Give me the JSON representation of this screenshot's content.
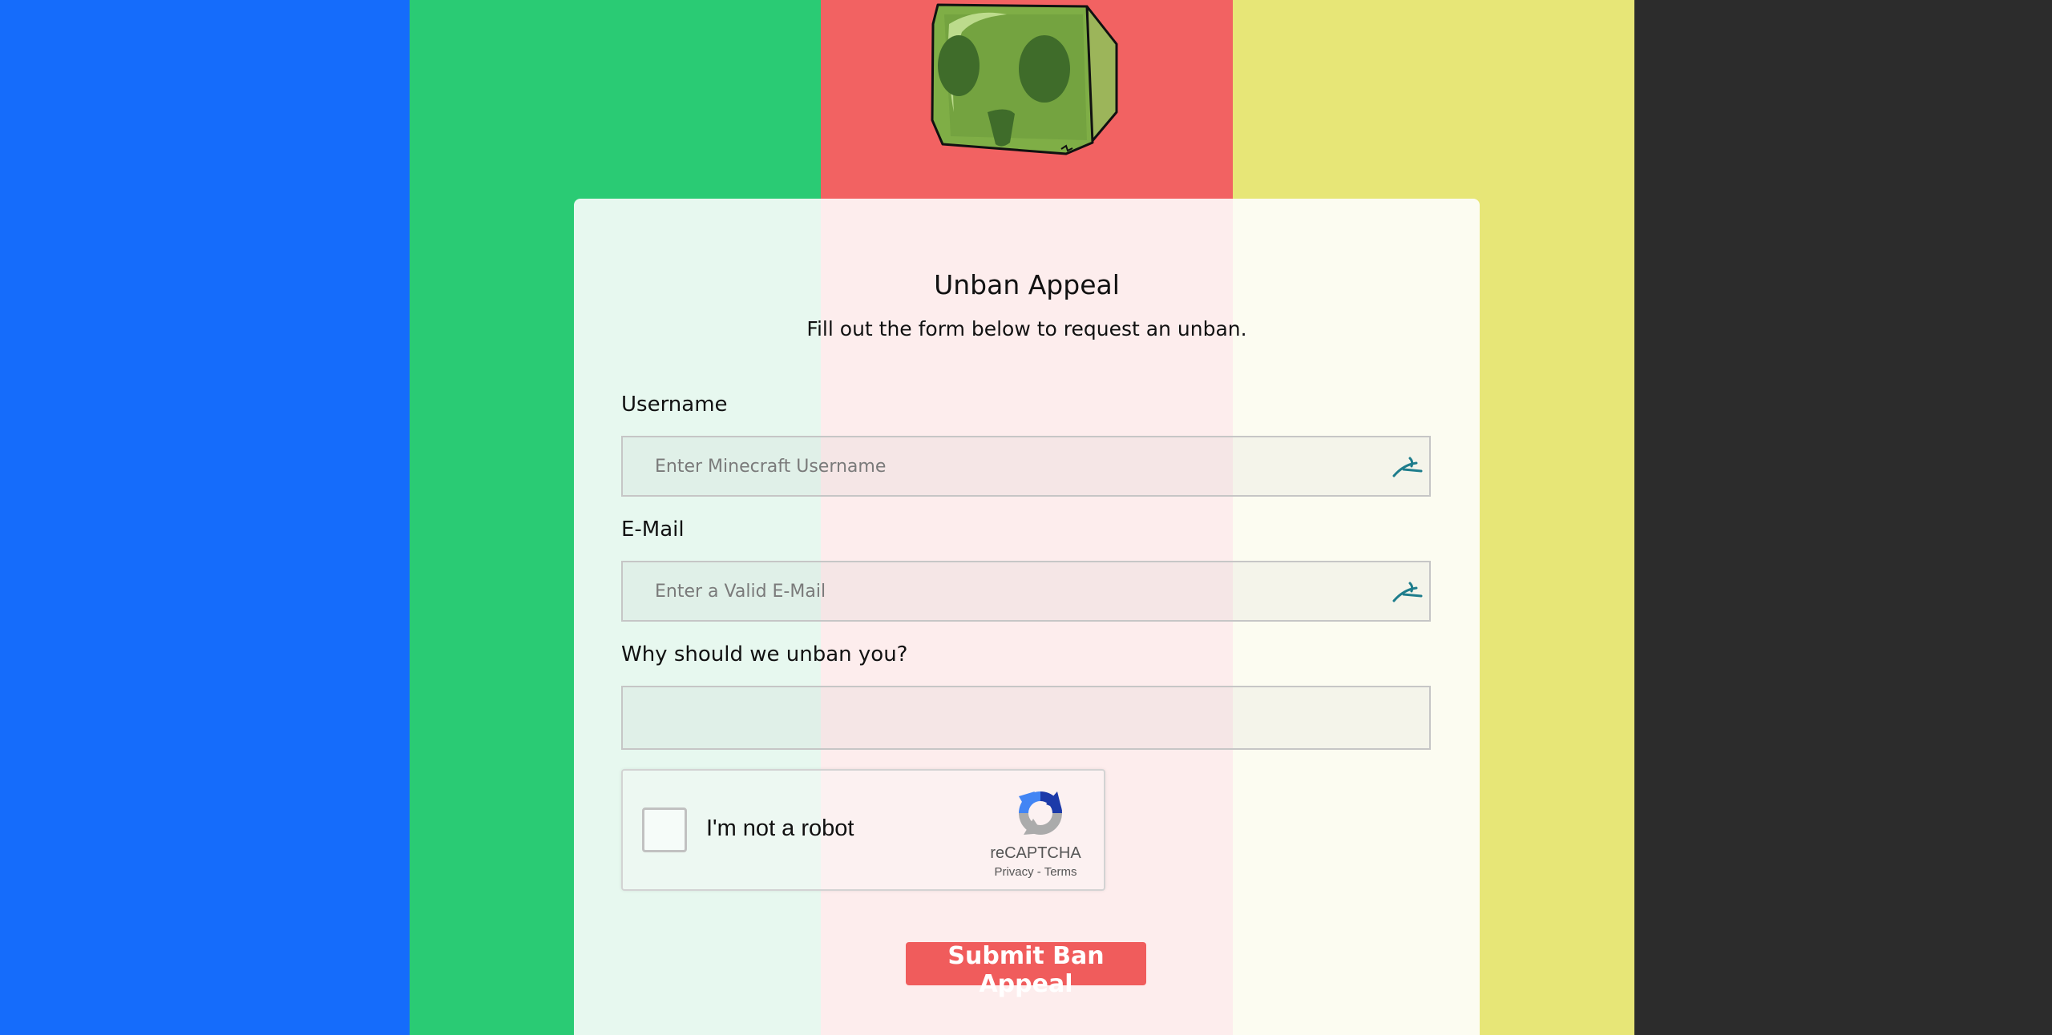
{
  "colors": {
    "stripes": [
      "#156cfb",
      "#2acb74",
      "#f26262",
      "#e7e677",
      "#2c2c2c"
    ],
    "card_tints": [
      "#e7f8ef",
      "#fdeded",
      "#fcfcf1"
    ],
    "submit_button": "#f05c5c",
    "input_icon": "#1e7d8c"
  },
  "logo": {
    "icon": "slime-cube-icon"
  },
  "form": {
    "title": "Unban Appeal",
    "subtitle": "Fill out the form below to request an unban.",
    "username": {
      "label": "Username",
      "placeholder": "Enter Minecraft Username",
      "value": "",
      "icon": "pen-icon"
    },
    "email": {
      "label": "E-Mail",
      "placeholder": "Enter a Valid E-Mail",
      "value": "",
      "icon": "pen-icon"
    },
    "reason": {
      "label": "Why should we unban you?",
      "value": ""
    },
    "recaptcha": {
      "checkbox_label": "I'm not a robot",
      "checked": false,
      "brand": "reCAPTCHA",
      "privacy_link": "Privacy",
      "separator": " - ",
      "terms_link": "Terms",
      "icon": "recaptcha-logo-icon"
    },
    "submit_label": "Submit Ban Appeal"
  }
}
